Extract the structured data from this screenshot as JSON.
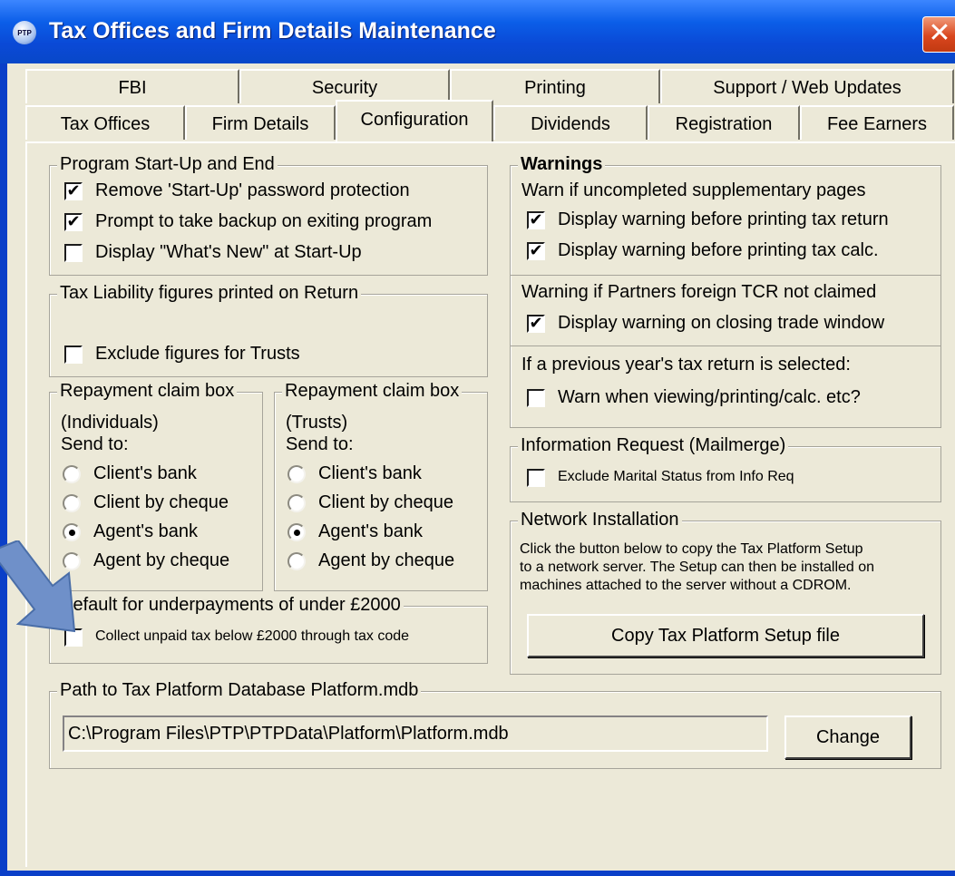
{
  "window": {
    "title": "Tax Offices and Firm Details Maintenance",
    "icon_label": "PTP",
    "close_glyph": "✕"
  },
  "tabs": {
    "row1": [
      "FBI",
      "Security",
      "Printing",
      "Support / Web Updates"
    ],
    "row2": [
      "Tax Offices",
      "Firm Details",
      "Configuration",
      "Dividends",
      "Registration",
      "Fee Earners"
    ],
    "active": "Configuration"
  },
  "startup": {
    "legend": "Program Start-Up and End",
    "items": [
      {
        "label": "Remove 'Start-Up' password protection",
        "checked": true
      },
      {
        "label": "Prompt to take backup on exiting program",
        "checked": true
      },
      {
        "label": "Display \"What's New\" at Start-Up",
        "checked": false
      }
    ]
  },
  "liability": {
    "legend": "Tax Liability figures printed on Return",
    "item": {
      "label": "Exclude figures for Trusts",
      "checked": false
    }
  },
  "repay_individuals": {
    "legend": "Repayment claim box",
    "sub1": "(Individuals)",
    "sub2": "Send to:",
    "options": [
      "Client's bank",
      "Client by cheque",
      "Agent's bank",
      "Agent by cheque"
    ],
    "selected": 2
  },
  "repay_trusts": {
    "legend": "Repayment claim box",
    "sub1": "(Trusts)",
    "sub2": "Send to:",
    "options": [
      "Client's bank",
      "Client by cheque",
      "Agent's bank",
      "Agent by cheque"
    ],
    "selected": 2
  },
  "underpay": {
    "legend": "Default for underpayments of under £2000",
    "item": {
      "label": "Collect unpaid tax below £2000 through tax code",
      "checked": false
    }
  },
  "warnings": {
    "legend": "Warnings",
    "sec1_heading": "Warn if uncompleted supplementary pages",
    "sec1_items": [
      {
        "label": "Display warning before printing tax return",
        "checked": true
      },
      {
        "label": "Display warning before printing tax calc.",
        "checked": true
      }
    ],
    "sec2_heading": "Warning if Partners foreign TCR not claimed",
    "sec2_item": {
      "label": "Display warning on closing trade window",
      "checked": true
    },
    "sec3_heading": "If a previous year's tax return is selected:",
    "sec3_item": {
      "label": "Warn when viewing/printing/calc. etc?",
      "checked": false
    }
  },
  "info_request": {
    "legend": "Information Request (Mailmerge)",
    "item": {
      "label": "Exclude Marital Status from Info Req",
      "checked": false
    }
  },
  "network": {
    "legend": "Network Installation",
    "text1": "Click the button below to copy the Tax Platform Setup",
    "text2": "to a network server. The Setup can then be installed on",
    "text3": "machines attached to the server without a CDROM.",
    "button": "Copy Tax Platform Setup file"
  },
  "path": {
    "legend": "Path to Tax Platform Database Platform.mdb",
    "value": "C:\\Program Files\\PTP\\PTPData\\Platform\\Platform.mdb",
    "button": "Change"
  },
  "colors": {
    "titlebar": "#0a49d6",
    "face": "#ece9d8",
    "close": "#d9461e",
    "arrow": "#6f90c9"
  },
  "annotation": {
    "arrow_icon": "arrow-down-right-icon"
  }
}
